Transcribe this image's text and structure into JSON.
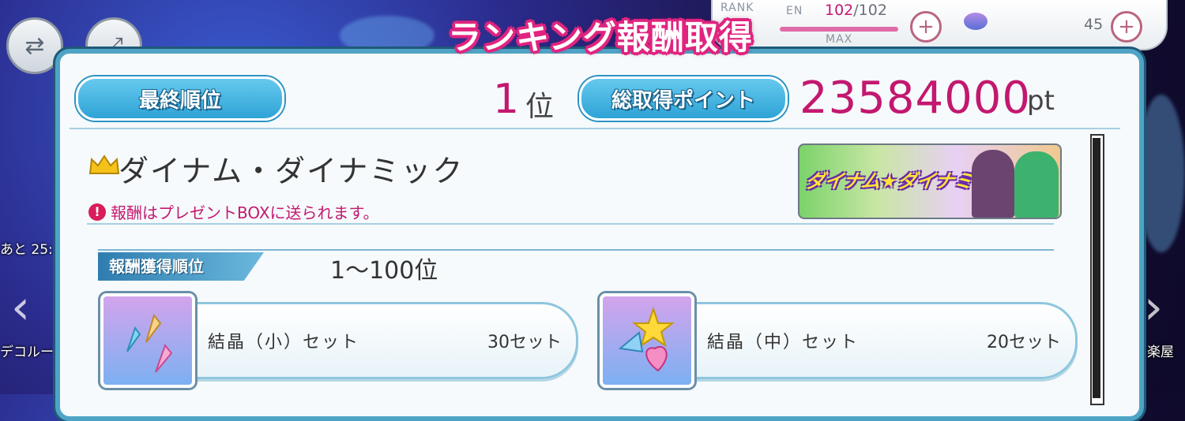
{
  "hud": {
    "rank_label": "RANK",
    "en_label": "EN",
    "en_current": "102",
    "en_max": "/102",
    "en_max_label": "MAX",
    "currency_value": "45",
    "plus": "+"
  },
  "side": {
    "left_label": "デコルー",
    "left_timer": "あと 25:",
    "right_label": "楽屋"
  },
  "modal": {
    "title": "ランキング報酬取得",
    "final_rank_label": "最終順位",
    "final_rank_value": "1",
    "final_rank_unit": "位",
    "total_points_label": "総取得ポイント",
    "total_points_value": "23584000",
    "total_points_unit": "pt",
    "event_name": "ダイナム・ダイナミック",
    "notice": "報酬はプレゼントBOXに送られます。",
    "banner_logo": "ダイナム★ダイナミック",
    "tier_label": "報酬獲得順位",
    "tier_value": "1〜100位",
    "rewards": [
      {
        "name": "結晶（小）セット",
        "count": "30セット",
        "icon": "small-crystal-set-icon"
      },
      {
        "name": "結晶（中）セット",
        "count": "20セット",
        "icon": "medium-crystal-set-icon"
      }
    ]
  },
  "colors": {
    "accent_pink": "#c3186f",
    "frame_blue": "#4fa4c6"
  }
}
